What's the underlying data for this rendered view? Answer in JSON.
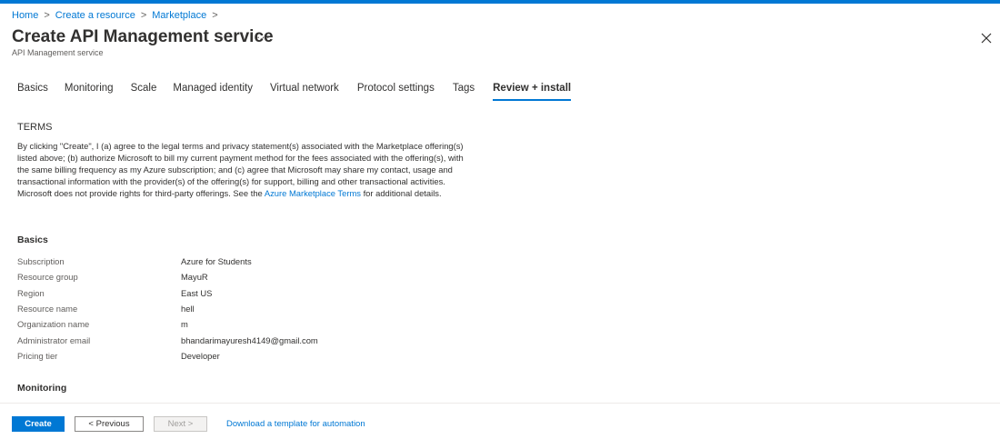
{
  "breadcrumb": {
    "items": [
      "Home",
      "Create a resource",
      "Marketplace"
    ],
    "separator": ">"
  },
  "header": {
    "title": "Create API Management service",
    "more_label": "···",
    "subtitle": "API Management service",
    "close_icon": "close-icon"
  },
  "tabs": [
    {
      "label": "Basics",
      "active": false
    },
    {
      "label": "Monitoring",
      "active": false
    },
    {
      "label": "Scale",
      "active": false
    },
    {
      "label": "Managed identity",
      "active": false
    },
    {
      "label": "Virtual network",
      "active": false
    },
    {
      "label": "Protocol settings",
      "active": false
    },
    {
      "label": "Tags",
      "active": false
    },
    {
      "label": "Review + install",
      "active": true
    }
  ],
  "terms": {
    "heading": "TERMS",
    "text_before_link": "By clicking \"Create\", I (a) agree to the legal terms and privacy statement(s) associated with the Marketplace offering(s) listed above; (b) authorize Microsoft to bill my current payment method for the fees associated with the offering(s), with the same billing frequency as my Azure subscription; and (c) agree that Microsoft may share my contact, usage and transactional information with the provider(s) of the offering(s) for support, billing and other transactional activities. Microsoft does not provide rights for third-party offerings. See the ",
    "link_text": "Azure Marketplace Terms",
    "text_after_link": " for additional details."
  },
  "basics": {
    "heading": "Basics",
    "rows": [
      {
        "label": "Subscription",
        "value": "Azure for Students"
      },
      {
        "label": "Resource group",
        "value": "MayuR"
      },
      {
        "label": "Region",
        "value": "East US"
      },
      {
        "label": "Resource name",
        "value": "hell"
      },
      {
        "label": "Organization name",
        "value": "m"
      },
      {
        "label": "Administrator email",
        "value": "bhandarimayuresh4149@gmail.com"
      },
      {
        "label": "Pricing tier",
        "value": "Developer"
      }
    ]
  },
  "monitoring": {
    "heading": "Monitoring"
  },
  "footer": {
    "create_label": "Create",
    "previous_label": "< Previous",
    "next_label": "Next >",
    "template_link": "Download a template for automation"
  },
  "colors": {
    "accent": "#0078d4",
    "text": "#323130",
    "muted": "#605e5c"
  }
}
